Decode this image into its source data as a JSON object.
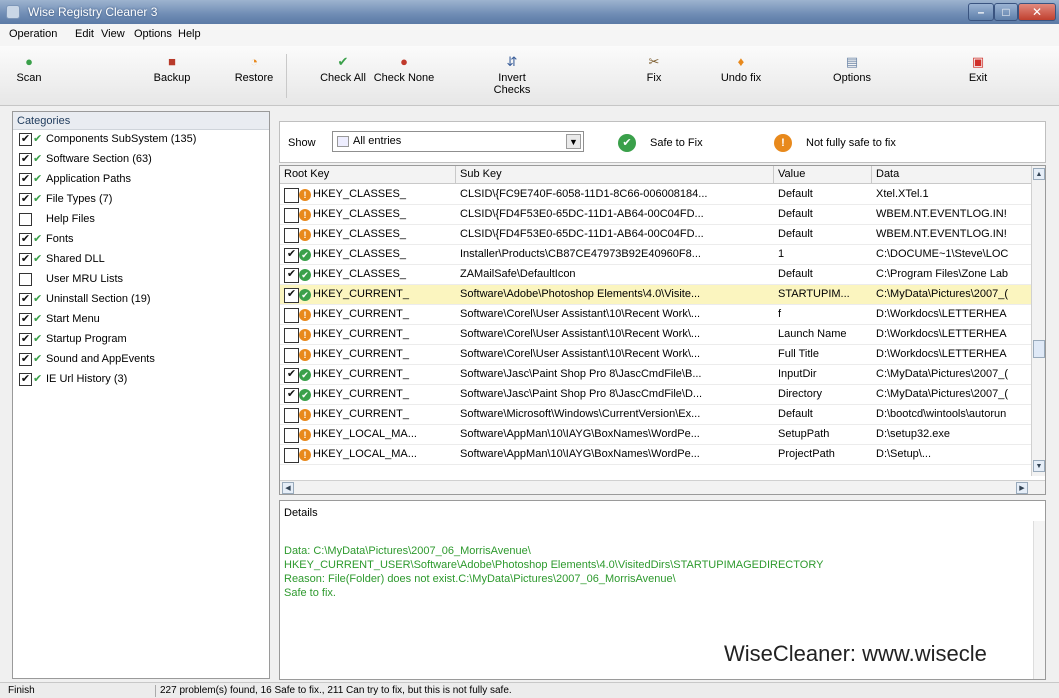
{
  "window": {
    "title": "Wise Registry Cleaner 3"
  },
  "menu": [
    "Operation",
    "Edit",
    "View",
    "Options",
    "Help"
  ],
  "toolbar": [
    {
      "label": "Scan",
      "icon": "scan-icon"
    },
    {
      "label": "Backup",
      "icon": "backup-icon"
    },
    {
      "label": "Restore",
      "icon": "restore-icon"
    },
    {
      "label": "Check All",
      "icon": "check-all-icon"
    },
    {
      "label": "Check None",
      "icon": "check-none-icon"
    },
    {
      "label": "Invert Checks",
      "icon": "invert-checks-icon"
    },
    {
      "label": "Fix",
      "icon": "fix-icon"
    },
    {
      "label": "Undo fix",
      "icon": "undo-fix-icon"
    },
    {
      "label": "Options",
      "icon": "options-icon"
    },
    {
      "label": "Exit",
      "icon": "exit-icon"
    }
  ],
  "categories": {
    "header": "Categories",
    "items": [
      {
        "label": "Components SubSystem (135)",
        "checked": true,
        "ok": true
      },
      {
        "label": "Software Section (63)",
        "checked": true,
        "ok": true
      },
      {
        "label": "Application Paths",
        "checked": true,
        "ok": true
      },
      {
        "label": "File Types (7)",
        "checked": true,
        "ok": true
      },
      {
        "label": "Help Files",
        "checked": false,
        "ok": false
      },
      {
        "label": "Fonts",
        "checked": true,
        "ok": true
      },
      {
        "label": "Shared DLL",
        "checked": true,
        "ok": true
      },
      {
        "label": "User MRU Lists",
        "checked": false,
        "ok": false
      },
      {
        "label": "Uninstall Section (19)",
        "checked": true,
        "ok": true
      },
      {
        "label": "Start Menu",
        "checked": true,
        "ok": true
      },
      {
        "label": "Startup Program",
        "checked": true,
        "ok": true
      },
      {
        "label": "Sound and AppEvents",
        "checked": true,
        "ok": true
      },
      {
        "label": "IE Url History (3)",
        "checked": true,
        "ok": true
      }
    ]
  },
  "filter": {
    "show_label": "Show",
    "selected": "All entries",
    "safe_label": "Safe to Fix",
    "not_safe_label": "Not fully safe to fix"
  },
  "grid": {
    "columns": [
      "Root Key",
      "Sub Key",
      "Value",
      "Data"
    ],
    "rows": [
      {
        "checked": false,
        "safe": false,
        "root": "HKEY_CLASSES_",
        "sub": "CLSID\\{FC9E740F-6058-11D1-8C66-006008184...",
        "value": "Default",
        "data": "Xtel.XTel.1"
      },
      {
        "checked": false,
        "safe": false,
        "root": "HKEY_CLASSES_",
        "sub": "CLSID\\{FD4F53E0-65DC-11D1-AB64-00C04FD...",
        "value": "Default",
        "data": "WBEM.NT.EVENTLOG.IN!"
      },
      {
        "checked": false,
        "safe": false,
        "root": "HKEY_CLASSES_",
        "sub": "CLSID\\{FD4F53E0-65DC-11D1-AB64-00C04FD...",
        "value": "Default",
        "data": "WBEM.NT.EVENTLOG.IN!"
      },
      {
        "checked": true,
        "safe": true,
        "root": "HKEY_CLASSES_",
        "sub": "Installer\\Products\\CB87CE47973B92E40960F8...",
        "value": "1",
        "data": "C:\\DOCUME~1\\Steve\\LOC"
      },
      {
        "checked": true,
        "safe": true,
        "root": "HKEY_CLASSES_",
        "sub": "ZAMailSafe\\DefaultIcon",
        "value": "Default",
        "data": "C:\\Program Files\\Zone Lab"
      },
      {
        "checked": true,
        "safe": true,
        "root": "HKEY_CURRENT_",
        "sub": "Software\\Adobe\\Photoshop Elements\\4.0\\Visite...",
        "value": "STARTUPIM...",
        "data": "C:\\MyData\\Pictures\\2007_(",
        "selected": true
      },
      {
        "checked": false,
        "safe": false,
        "root": "HKEY_CURRENT_",
        "sub": "Software\\Corel\\User Assistant\\10\\Recent Work\\...",
        "value": "f",
        "data": "D:\\Workdocs\\LETTERHEA"
      },
      {
        "checked": false,
        "safe": false,
        "root": "HKEY_CURRENT_",
        "sub": "Software\\Corel\\User Assistant\\10\\Recent Work\\...",
        "value": "Launch Name",
        "data": "D:\\Workdocs\\LETTERHEA"
      },
      {
        "checked": false,
        "safe": false,
        "root": "HKEY_CURRENT_",
        "sub": "Software\\Corel\\User Assistant\\10\\Recent Work\\...",
        "value": "Full Title",
        "data": "D:\\Workdocs\\LETTERHEA"
      },
      {
        "checked": true,
        "safe": true,
        "root": "HKEY_CURRENT_",
        "sub": "Software\\Jasc\\Paint Shop Pro 8\\JascCmdFile\\B...",
        "value": "InputDir",
        "data": "C:\\MyData\\Pictures\\2007_("
      },
      {
        "checked": true,
        "safe": true,
        "root": "HKEY_CURRENT_",
        "sub": "Software\\Jasc\\Paint Shop Pro 8\\JascCmdFile\\D...",
        "value": "Directory",
        "data": "C:\\MyData\\Pictures\\2007_("
      },
      {
        "checked": false,
        "safe": false,
        "root": "HKEY_CURRENT_",
        "sub": "Software\\Microsoft\\Windows\\CurrentVersion\\Ex...",
        "value": "Default",
        "data": "D:\\bootcd\\wintools\\autorun"
      },
      {
        "checked": false,
        "safe": false,
        "root": "HKEY_LOCAL_MA...",
        "sub": "Software\\AppMan\\10\\IAYG\\BoxNames\\WordPe...",
        "value": "SetupPath",
        "data": "D:\\setup32.exe"
      },
      {
        "checked": false,
        "safe": false,
        "root": "HKEY_LOCAL_MA...",
        "sub": "Software\\AppMan\\10\\IAYG\\BoxNames\\WordPe...",
        "value": "ProjectPath",
        "data": "D:\\Setup\\..."
      }
    ]
  },
  "details": {
    "header": "Details",
    "lines": [
      "Data: C:\\MyData\\Pictures\\2007_06_MorrisAvenue\\",
      "HKEY_CURRENT_USER\\Software\\Adobe\\Photoshop Elements\\4.0\\VisitedDirs\\STARTUPIMAGEDIRECTORY",
      "Reason: File(Folder) does not exist.C:\\MyData\\Pictures\\2007_06_MorrisAvenue\\",
      "Safe to fix."
    ],
    "watermark": "WiseCleaner: www.wisecle"
  },
  "status": {
    "left": "Finish",
    "right": "227 problem(s) found, 16 Safe to fix., 211 Can try to fix, but this is not fully safe."
  },
  "colors": {
    "safe": "#3aa04a",
    "not_safe": "#e8891c",
    "selected_row": "#fbf5bf",
    "detail_text": "#2e9a2e"
  }
}
